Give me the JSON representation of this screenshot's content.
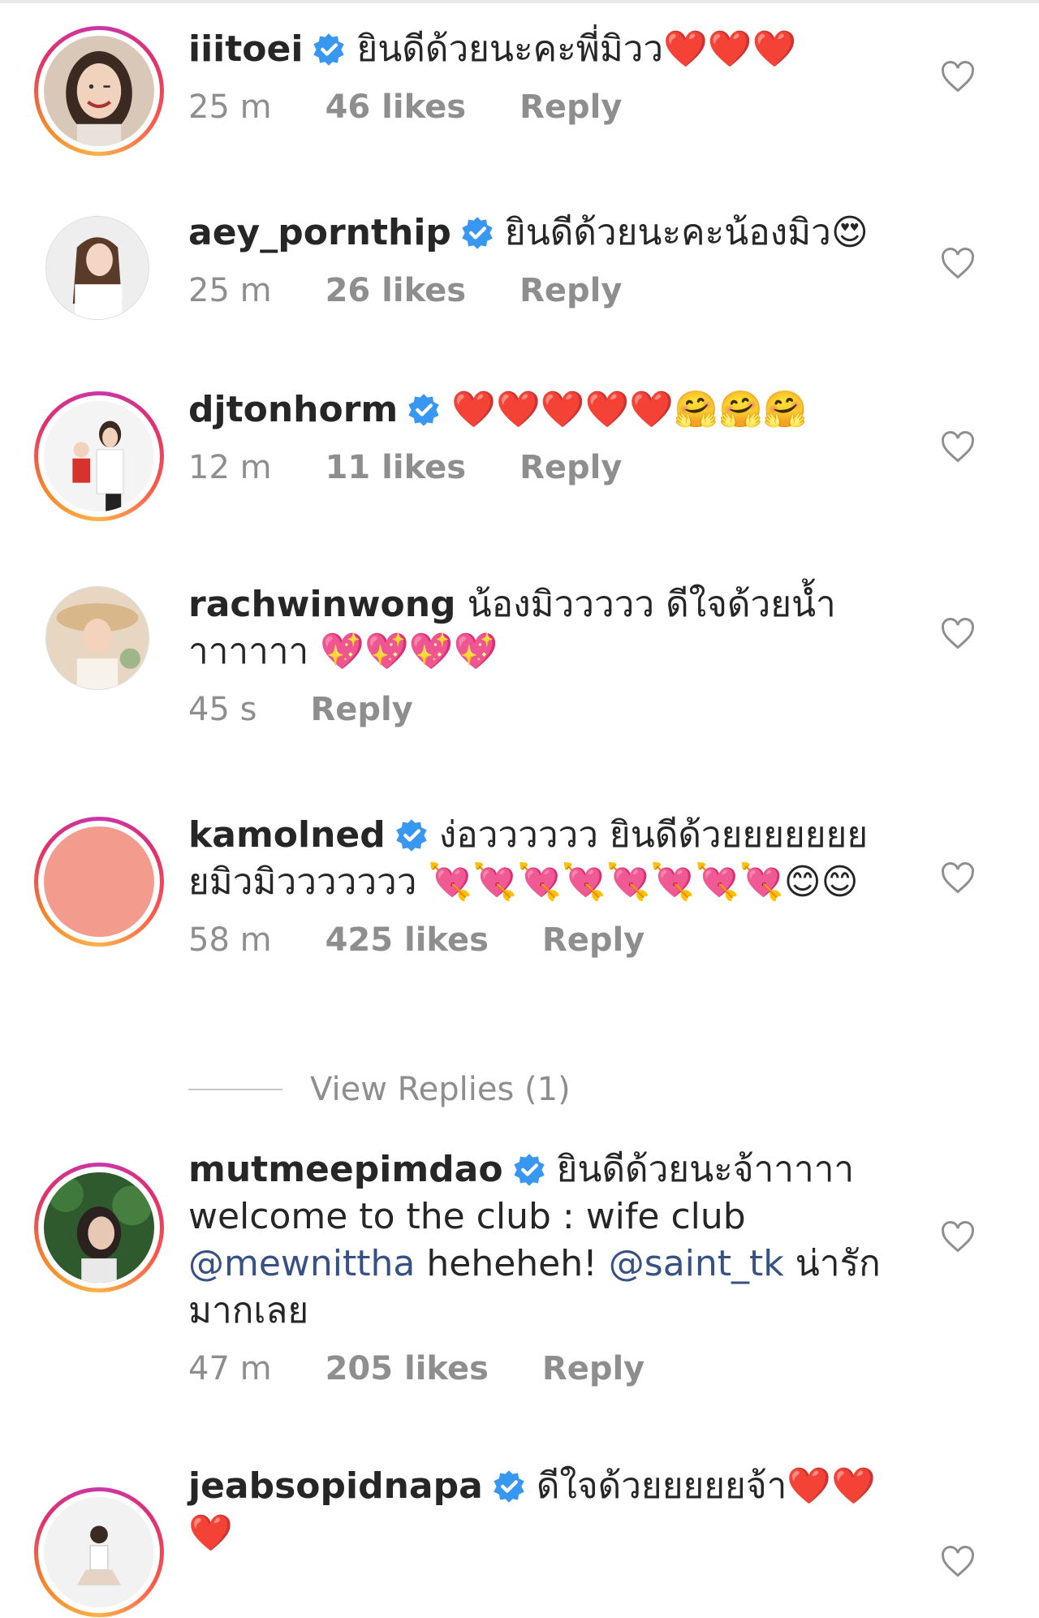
{
  "colors": {
    "verified": "#3897f0",
    "mention": "#385185",
    "meta": "#8e8e8e",
    "heart": "#e01e35"
  },
  "comments": [
    {
      "username": "iiitoei",
      "verified": true,
      "text": "ยินดีด้วยนะคะพี่มิวว❤️❤️❤️",
      "time": "25 m",
      "likes": "46 likes",
      "reply": "Reply",
      "avatar_icon": "avatar-photo-woman-smiling"
    },
    {
      "username": "aey_pornthip",
      "verified": true,
      "text": "ยินดีด้วยนะคะน้องมิว😍",
      "time": "25 m",
      "likes": "26 likes",
      "reply": "Reply",
      "avatar_icon": "avatar-photo-woman-long-hair"
    },
    {
      "username": "djtonhorm",
      "verified": true,
      "text": "❤️❤️❤️❤️❤️🤗🤗🤗",
      "time": "12 m",
      "likes": "11 likes",
      "reply": "Reply",
      "avatar_icon": "avatar-photo-woman-with-child"
    },
    {
      "username": "rachwinwong",
      "verified": false,
      "text": "น้องมิววววว ดีใจด้วยน้ำาาาาาา 💖💖💖💖",
      "time": "45 s",
      "reply": "Reply",
      "avatar_icon": "avatar-photo-woman-sunhat"
    },
    {
      "username": "kamolned",
      "verified": true,
      "text": "ง่อวววววว ยินดีด้วยยยยยยยยมิวมิววววววว 💘💘💘💘💘💘💘💘😊😊",
      "time": "58 m",
      "likes": "425 likes",
      "reply": "Reply",
      "avatar_icon": "avatar-placeholder-salmon",
      "view_replies": "View Replies (1)"
    },
    {
      "username": "mutmeepimdao",
      "verified": true,
      "text_before": "ยินดีด้วยนะจ้าาาาา welcome to the club : wife club ",
      "mention1": "@mewnittha",
      "text_middle": " heheheh! ",
      "mention2": "@saint_tk",
      "text_after": " น่ารักมากเลย",
      "time": "47 m",
      "likes": "205 likes",
      "reply": "Reply",
      "avatar_icon": "avatar-photo-woman-greenery"
    },
    {
      "username": "jeabsopidnapa",
      "verified": true,
      "text": "ดีใจด้วยยยยยจ้า❤️❤️❤️",
      "avatar_icon": "avatar-photo-woman-sitting"
    }
  ]
}
